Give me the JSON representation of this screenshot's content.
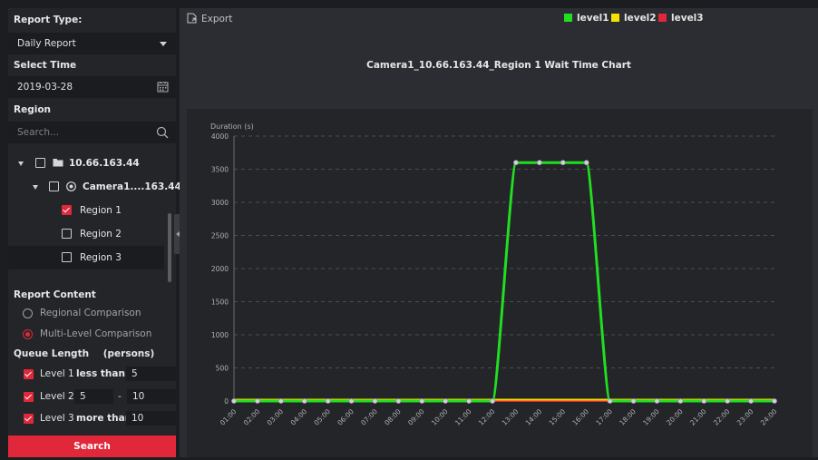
{
  "sidebar": {
    "report_type": {
      "label": "Report Type:",
      "value": "Daily Report"
    },
    "select_time": {
      "label": "Select Time",
      "value": "2019-03-28"
    },
    "region": {
      "label": "Region",
      "search_placeholder": "Search...",
      "tree": {
        "root": {
          "label": "10.66.163.44",
          "checked": false
        },
        "camera": {
          "label": "Camera1....163.44",
          "checked": false
        },
        "regions": [
          {
            "label": "Region 1",
            "checked": true
          },
          {
            "label": "Region 2",
            "checked": false
          },
          {
            "label": "Region 3",
            "checked": false
          }
        ]
      }
    },
    "report_content": {
      "label": "Report Content",
      "options": [
        {
          "label": "Regional Comparison",
          "selected": false
        },
        {
          "label": "Multi-Level Comparison",
          "selected": true
        }
      ]
    },
    "queue_length": {
      "label": "Queue Length",
      "unit": "(persons)",
      "level1": {
        "label": "Level 1",
        "condition": "less than",
        "value": "5",
        "checked": true
      },
      "level2": {
        "label": "Level 2",
        "from": "5",
        "separator": "-",
        "to": "10",
        "checked": true
      },
      "level3": {
        "label": "Level 3",
        "condition": "more than",
        "value": "10",
        "checked": true
      }
    },
    "search_button": "Search"
  },
  "toolbar": {
    "export_label": "Export"
  },
  "legend": [
    {
      "name": "level1",
      "color": "#22dd22"
    },
    {
      "name": "level2",
      "color": "#f2e300"
    },
    {
      "name": "level3",
      "color": "#e0283a"
    }
  ],
  "chart_title": "Camera1_10.66.163.44_Region 1 Wait Time Chart",
  "chart_data": {
    "type": "line",
    "title": "Camera1_10.66.163.44_Region 1 Wait Time Chart",
    "ylabel": "Duration (s)",
    "xlabel": "",
    "ylim": [
      0,
      4000
    ],
    "yticks": [
      0,
      500,
      1000,
      1500,
      2000,
      2500,
      3000,
      3500,
      4000
    ],
    "grid": true,
    "legend_position": "top-right",
    "categories": [
      "01:00",
      "02:00",
      "03:00",
      "04:00",
      "05:00",
      "06:00",
      "07:00",
      "08:00",
      "09:00",
      "10:00",
      "11:00",
      "12:00",
      "13:00",
      "14:00",
      "15:00",
      "16:00",
      "17:00",
      "18:00",
      "19:00",
      "20:00",
      "21:00",
      "22:00",
      "23:00",
      "24:00"
    ],
    "series": [
      {
        "name": "level1",
        "color": "#22dd22",
        "values": [
          0,
          0,
          0,
          0,
          0,
          0,
          0,
          0,
          0,
          0,
          0,
          0,
          3600,
          3600,
          3600,
          3600,
          0,
          0,
          0,
          0,
          0,
          0,
          0,
          0
        ]
      },
      {
        "name": "level2",
        "color": "#f2e300",
        "values": [
          0,
          0,
          0,
          0,
          0,
          0,
          0,
          0,
          0,
          0,
          0,
          0,
          0,
          0,
          0,
          0,
          0,
          0,
          0,
          0,
          0,
          0,
          0,
          0
        ]
      },
      {
        "name": "level3",
        "color": "#e0283a",
        "values": [
          0,
          0,
          0,
          0,
          0,
          0,
          0,
          0,
          0,
          0,
          0,
          0,
          0,
          0,
          0,
          0,
          0,
          0,
          0,
          0,
          0,
          0,
          0,
          0
        ]
      }
    ]
  }
}
